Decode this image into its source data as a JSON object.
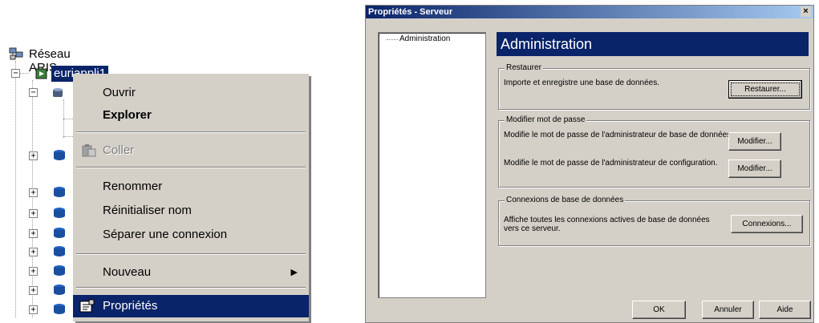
{
  "tree": {
    "root_label": "Réseau ARIS",
    "selected_node_label": "euriappli1"
  },
  "context_menu": {
    "open": "Ouvrir",
    "explore": "Explorer",
    "paste": "Coller",
    "rename": "Renommer",
    "reset_name": "Réinitialiser nom",
    "disconnect": "Séparer une connexion",
    "new": "Nouveau",
    "properties": "Propriétés"
  },
  "dialog": {
    "title": "Propriétés - Serveur",
    "close_glyph": "×",
    "nav_items": [
      "Administration"
    ],
    "header": "Administration",
    "restore": {
      "legend": "Restaurer",
      "text": "Importe et enregistre une base de données.",
      "button": "Restaurer..."
    },
    "password": {
      "legend": "Modifier mot de passe",
      "db_admin_text": "Modifie le mot de passe de l'administrateur de base de données.",
      "db_admin_button": "Modifier...",
      "config_admin_text": "Modifie le mot de passe de l'administrateur de configuration.",
      "config_admin_button": "Modifier..."
    },
    "connections": {
      "legend": "Connexions de base de données",
      "text_line1": "Affiche toutes les connexions actives de base de données",
      "text_line2": "vers ce serveur.",
      "button": "Connexions..."
    },
    "footer": {
      "ok": "OK",
      "cancel": "Annuler",
      "help": "Aide"
    }
  }
}
